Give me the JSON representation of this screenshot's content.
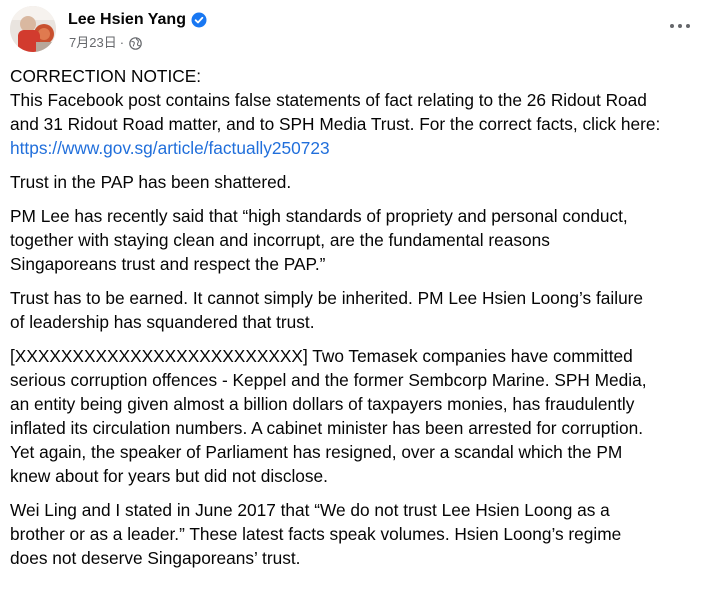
{
  "post": {
    "author": "Lee Hsien Yang",
    "date": "7月23日",
    "separator": "·",
    "privacy_icon": "globe-icon",
    "verified_icon": "verified-badge-icon",
    "more_icon": "more-options-icon",
    "colors": {
      "link": "#216fdb",
      "verified": "#1877f2",
      "meta": "#65676b",
      "text": "#050505"
    },
    "paragraphs": [
      {
        "lines": [
          "CORRECTION NOTICE:",
          "This Facebook post contains false statements of fact relating to the 26 Ridout Road",
          "and 31 Ridout Road matter, and to SPH Media Trust. For the correct facts, click here:"
        ],
        "link": "https://www.gov.sg/article/factually250723"
      },
      {
        "lines": [
          "Trust in the PAP has been shattered."
        ]
      },
      {
        "lines": [
          "PM Lee has recently said that “high standards of propriety and personal conduct,",
          "together with staying clean and incorrupt, are the fundamental reasons",
          "Singaporeans trust and respect the PAP.”"
        ]
      },
      {
        "lines": [
          "Trust has to be earned.  It cannot simply be inherited.  PM Lee Hsien Loong’s failure",
          "of leadership has squandered that trust."
        ]
      },
      {
        "lines": [
          "[XXXXXXXXXXXXXXXXXXXXXXXXX]  Two Temasek companies have committed",
          "serious corruption offences - Keppel and the former Sembcorp Marine.  SPH Media,",
          "an entity being given almost a billion dollars of taxpayers monies, has fraudulently",
          "inflated its circulation numbers. A cabinet minister has been arrested for corruption.",
          "Yet again, the speaker of Parliament has resigned, over a scandal which the PM",
          "knew about for years but did not disclose."
        ]
      },
      {
        "lines": [
          "Wei Ling and I stated in June 2017 that “We do not trust Lee Hsien Loong as a",
          "brother or as a leader.”  These latest facts speak volumes. Hsien Loong’s regime",
          "does not deserve Singaporeans’ trust."
        ]
      }
    ]
  }
}
